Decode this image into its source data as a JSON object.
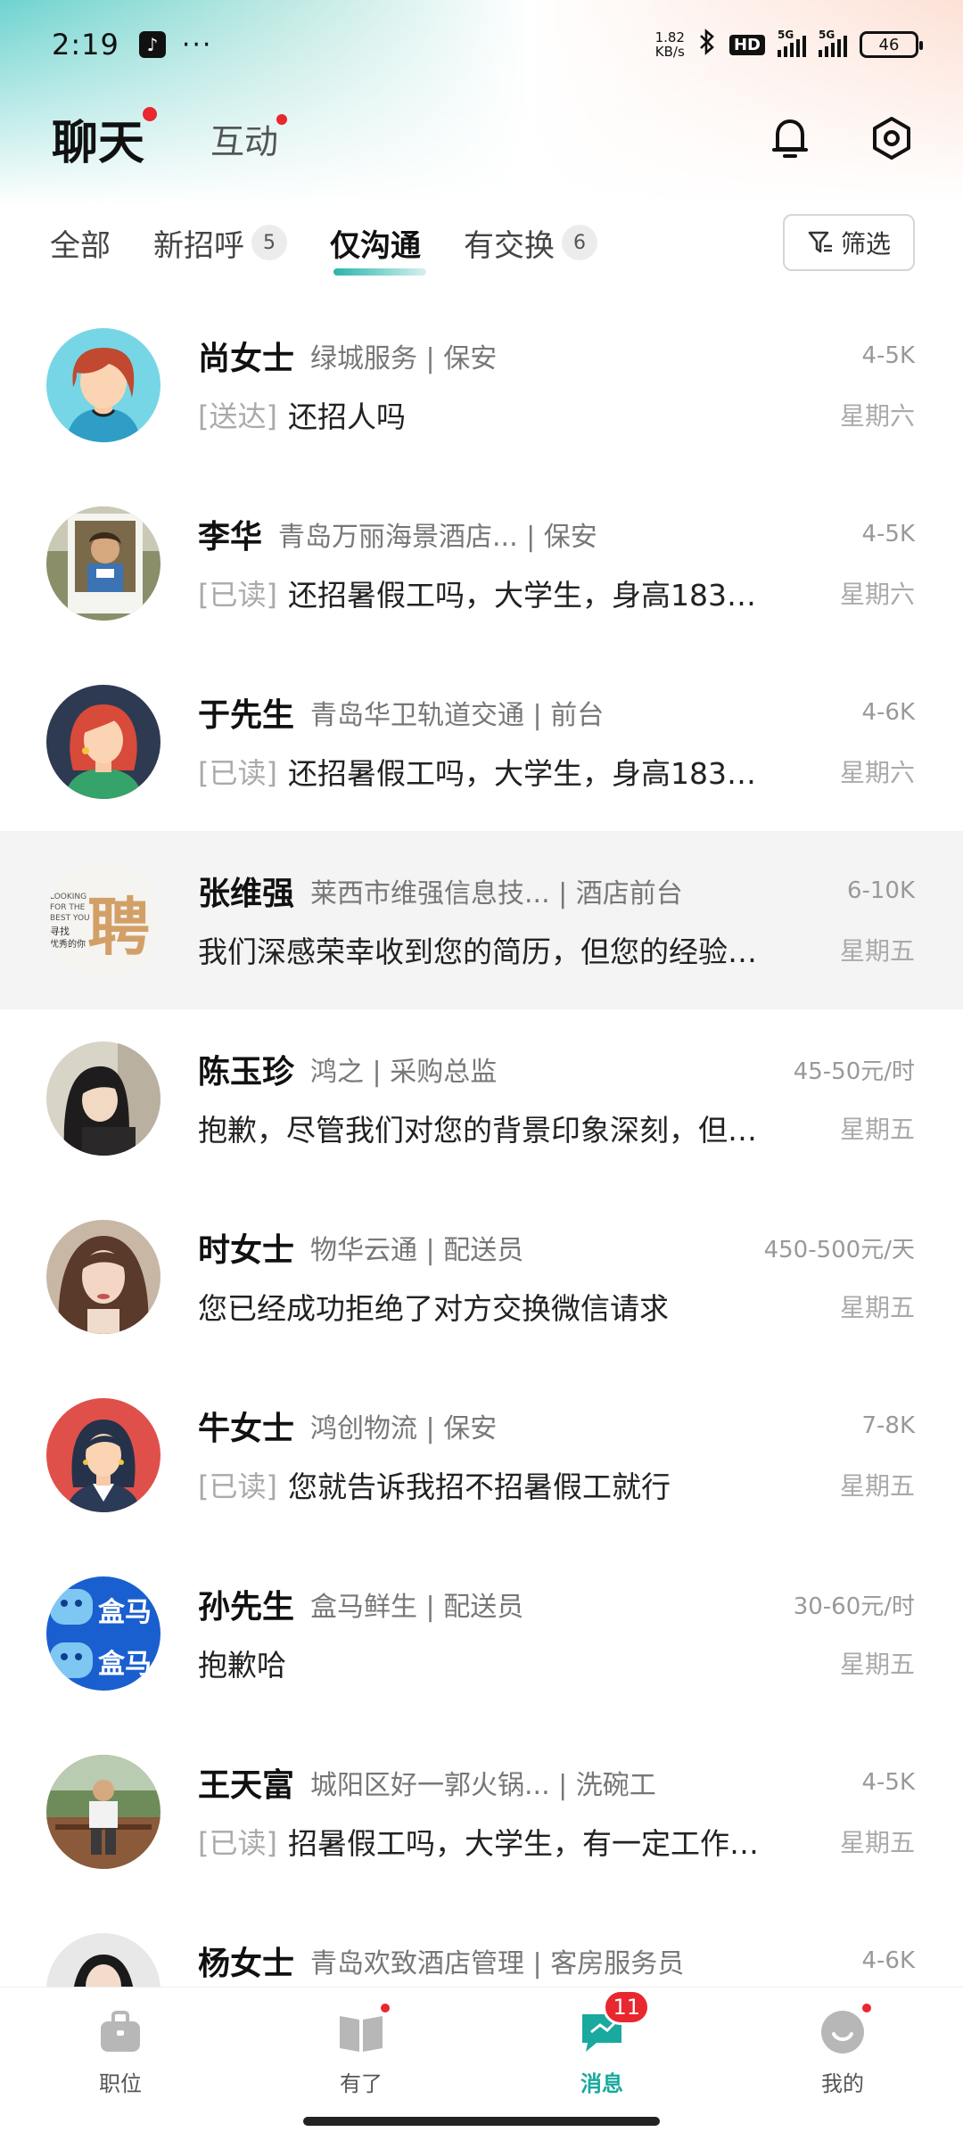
{
  "status_bar": {
    "time": "2:19",
    "net_speed_value": "1.82",
    "net_speed_unit": "KB/s",
    "hd_badge": "HD",
    "sim1": "5G",
    "sim2": "5G",
    "battery": "46"
  },
  "header": {
    "title": "聊天",
    "subtitle": "互动"
  },
  "filter_tabs": [
    {
      "label": "全部",
      "count": ""
    },
    {
      "label": "新招呼",
      "count": "5"
    },
    {
      "label": "仅沟通",
      "count": ""
    },
    {
      "label": "有交换",
      "count": "6"
    }
  ],
  "filter_button": "筛选",
  "chats": [
    {
      "name": "尚女士",
      "company": "绿城服务 | 保安",
      "salary": "4-5K",
      "status": "[送达]",
      "message": "还招人吗",
      "day": "星期六"
    },
    {
      "name": "李华",
      "company": "青岛万丽海景酒店... | 保安",
      "salary": "4-5K",
      "status": "[已读]",
      "message": "还招暑假工吗，大学生，身高183…",
      "day": "星期六"
    },
    {
      "name": "于先生",
      "company": "青岛华卫轨道交通 | 前台",
      "salary": "4-6K",
      "status": "[已读]",
      "message": "还招暑假工吗，大学生，身高183…",
      "day": "星期六"
    },
    {
      "name": "张维强",
      "company": "莱西市维强信息技... | 酒店前台",
      "salary": "6-10K",
      "status": "",
      "message": "我们深感荣幸收到您的简历，但您的经验…",
      "day": "星期五"
    },
    {
      "name": "陈玉珍",
      "company": "鸿之 | 采购总监",
      "salary": "45-50元/时",
      "status": "",
      "message": "抱歉，尽管我们对您的背景印象深刻，但…",
      "day": "星期五"
    },
    {
      "name": "时女士",
      "company": "物华云通 | 配送员",
      "salary": "450-500元/天",
      "status": "",
      "message": "您已经成功拒绝了对方交换微信请求",
      "day": "星期五"
    },
    {
      "name": "牛女士",
      "company": "鸿创物流 | 保安",
      "salary": "7-8K",
      "status": "[已读]",
      "message": "您就告诉我招不招暑假工就行",
      "day": "星期五"
    },
    {
      "name": "孙先生",
      "company": "盒马鲜生 | 配送员",
      "salary": "30-60元/时",
      "status": "",
      "message": "抱歉哈",
      "day": "星期五"
    },
    {
      "name": "王天富",
      "company": "城阳区好一郭火锅... | 洗碗工",
      "salary": "4-5K",
      "status": "[已读]",
      "message": "招暑假工吗，大学生，有一定工作…",
      "day": "星期五"
    },
    {
      "name": "杨女士",
      "company": "青岛欢致酒店管理 | 客房服务员",
      "salary": "4-6K",
      "status": "",
      "message": "",
      "day": ""
    }
  ],
  "avatar_texts": {
    "hema": "盒马",
    "pin": "聘",
    "pin_small1": "LOOKING",
    "pin_small2": "FOR THE",
    "pin_small3": "BEST YOU",
    "pin_small4": "寻找",
    "pin_small5": "优秀的你"
  },
  "bottom_nav": [
    {
      "label": "职位",
      "badge": ""
    },
    {
      "label": "有了",
      "badge": ""
    },
    {
      "label": "消息",
      "badge": "11"
    },
    {
      "label": "我的",
      "badge": ""
    }
  ],
  "colors": {
    "accent": "#19a99e",
    "red_dot": "#e8272f"
  }
}
